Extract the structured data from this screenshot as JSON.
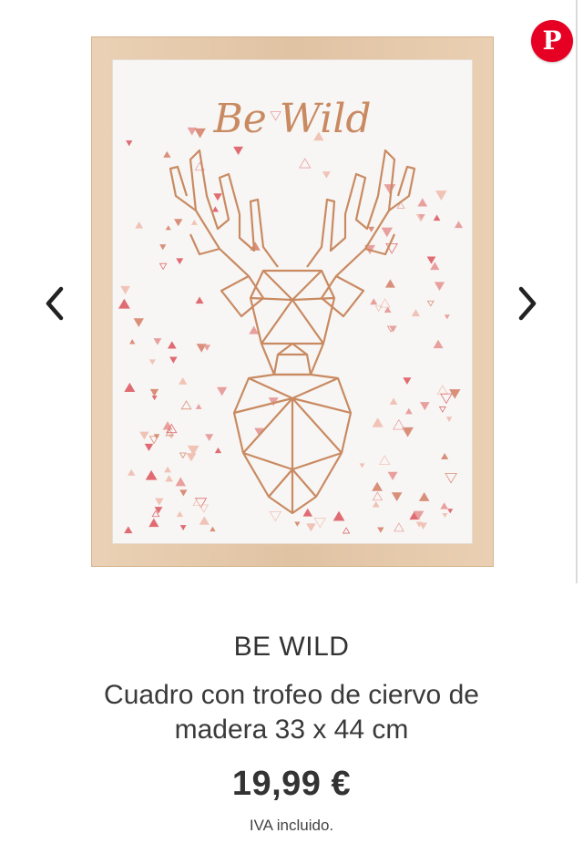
{
  "pinterest_icon": "pinterest-icon",
  "image": {
    "headline": "Be Wild",
    "colors": {
      "frame": "#e7c9a8",
      "copper": "#c98a62",
      "triangles": [
        "#e06b73",
        "#e8a09e",
        "#d98f7a",
        "#f1c3b7"
      ]
    }
  },
  "nav": {
    "prev_icon": "chevron-left-icon",
    "next_icon": "chevron-right-icon"
  },
  "product": {
    "brand": "BE WILD",
    "title": "Cuadro con trofeo de ciervo de madera 33 x 44 cm",
    "price": "19,99 €",
    "tax_note": "IVA incluido."
  }
}
